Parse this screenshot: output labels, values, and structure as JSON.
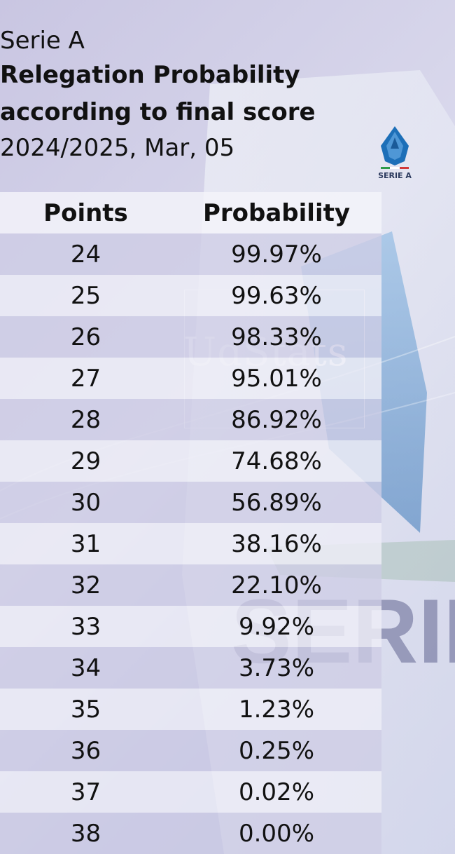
{
  "header": {
    "series": "Serie A",
    "title_line1": "Relegation Probability",
    "title_line2": "according to final score",
    "date": "2024/2025, Mar, 05"
  },
  "logo_label": "SERIE A",
  "watermark": "UdStats",
  "columns": [
    "Points",
    "Probability"
  ],
  "chart_data": {
    "type": "table",
    "title": "Relegation Probability according to final score",
    "columns": [
      "Points",
      "Probability"
    ],
    "rows": [
      [
        "24",
        "99.97%"
      ],
      [
        "25",
        "99.63%"
      ],
      [
        "26",
        "98.33%"
      ],
      [
        "27",
        "95.01%"
      ],
      [
        "28",
        "86.92%"
      ],
      [
        "29",
        "74.68%"
      ],
      [
        "30",
        "56.89%"
      ],
      [
        "31",
        "38.16%"
      ],
      [
        "32",
        "22.10%"
      ],
      [
        "33",
        "9.92%"
      ],
      [
        "34",
        "3.73%"
      ],
      [
        "35",
        "1.23%"
      ],
      [
        "36",
        "0.25%"
      ],
      [
        "37",
        "0.02%"
      ],
      [
        "38",
        "0.00%"
      ]
    ]
  },
  "colors": {
    "logo_blue": "#1d6fb8",
    "logo_green": "#2e9b4a",
    "logo_red": "#d23a3a"
  }
}
